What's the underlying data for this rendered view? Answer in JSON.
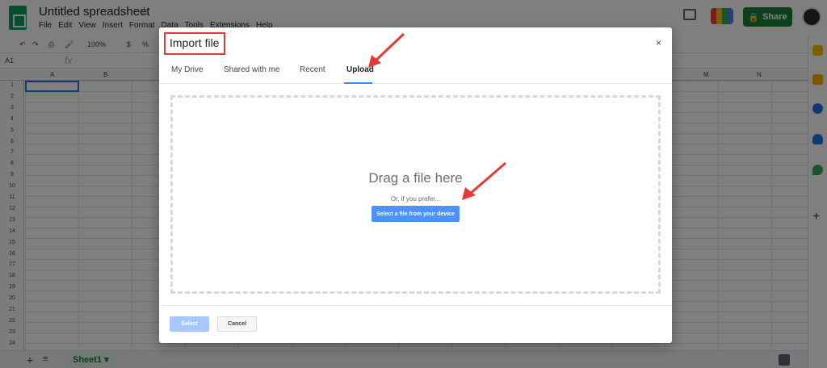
{
  "app": {
    "doc_title": "Untitled spreadsheet",
    "menu": [
      "File",
      "Edit",
      "View",
      "Insert",
      "Format",
      "Data",
      "Tools",
      "Extensions",
      "Help"
    ],
    "share_label": "Share",
    "toolbar": {
      "zoom": "100%",
      "currency": "$",
      "percent": "%"
    },
    "name_box": "A1",
    "fx_label": "fx",
    "columns": [
      "A",
      "B",
      "M",
      "N"
    ],
    "rows": [
      "1",
      "2",
      "3",
      "4",
      "5",
      "6",
      "7",
      "8",
      "9",
      "10",
      "11",
      "12",
      "13",
      "14",
      "15",
      "16",
      "17",
      "18",
      "19",
      "20",
      "21",
      "22",
      "23",
      "24"
    ],
    "sheet_tab": "Sheet1"
  },
  "dialog": {
    "title": "Import file",
    "close_label": "×",
    "tabs": [
      "My Drive",
      "Shared with me",
      "Recent",
      "Upload"
    ],
    "active_tab": "Upload",
    "drag_text": "Drag a file here",
    "or_text": "Or, if you prefer...",
    "select_device_label": "Select a file from your device",
    "select_label": "Select",
    "cancel_label": "Cancel"
  },
  "colors": {
    "share_green": "#188038",
    "accent_blue": "#4d90fe",
    "highlight_red": "#e53935"
  }
}
